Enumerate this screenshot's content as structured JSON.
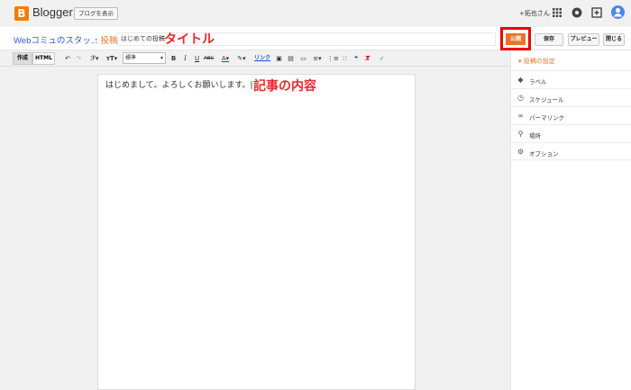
{
  "app": {
    "name": "Blogger",
    "logo_letter": "B",
    "view_blog_label": "ブログを表示",
    "user_label": "+拓也さん"
  },
  "header": {
    "blog_name": "Webコミュのスタッ...",
    "crumb": "・投稿",
    "title_value": "はじめての投稿",
    "title_annotation": "タイトル"
  },
  "actions": {
    "publish": "公開",
    "save": "保存",
    "preview": "プレビュー",
    "close": "閉じる"
  },
  "toolbar": {
    "compose": "作成",
    "html": "HTML",
    "font_value": "標準",
    "link": "リンク"
  },
  "editor": {
    "body": "はじめまして。よろしくお願いします。|",
    "content_annotation": "記事の内容"
  },
  "sidebar": {
    "header": "▾ 投稿の設定",
    "items": [
      {
        "label": "ラベル",
        "icon": "label-icon"
      },
      {
        "label": "スケジュール",
        "icon": "clock-icon"
      },
      {
        "label": "パーマリンク",
        "icon": "link-icon"
      },
      {
        "label": "場所",
        "icon": "location-icon"
      },
      {
        "label": "オプション",
        "icon": "gear-icon"
      }
    ]
  },
  "colors": {
    "brand": "#f57c00",
    "accent_orange": "#e4792f",
    "annotation_red": "#e8282b",
    "link_blue": "#2e5fc9"
  }
}
